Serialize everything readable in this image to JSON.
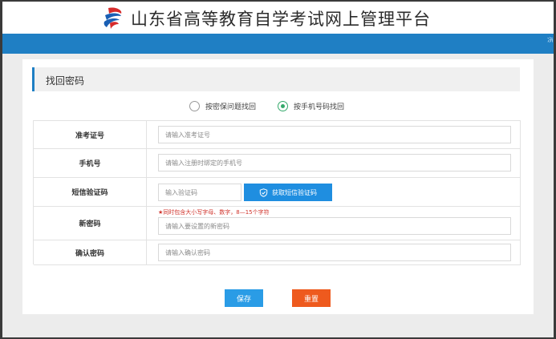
{
  "header": {
    "title": "山东省高等教育自学考试网上管理平台",
    "logo_icon": "shandong-exam-logo-icon",
    "bar_color": "#1f7fc4",
    "bar_edge_text": "浣"
  },
  "section": {
    "title": "找回密码"
  },
  "recovery_options": [
    {
      "label": "按密保问题找回",
      "checked": false
    },
    {
      "label": "按手机号码找回",
      "checked": true
    }
  ],
  "form": {
    "exam_id": {
      "label": "准考证号",
      "placeholder": "请输入准考证号"
    },
    "phone": {
      "label": "手机号",
      "placeholder": "请输入注册时绑定的手机号"
    },
    "sms_code": {
      "label": "短信验证码",
      "placeholder": "输入验证码",
      "button_label": "获取短信验证码",
      "button_icon": "shield-check-icon"
    },
    "new_password": {
      "label": "新密码",
      "hint": "★同时包含大小写字母、数字，8—15个字符",
      "placeholder": "请输入要设置的新密码"
    },
    "confirm_password": {
      "label": "确认密码",
      "placeholder": "请输入确认密码"
    }
  },
  "actions": {
    "save_label": "保存",
    "reset_label": "重置",
    "save_color": "#2a9ce6",
    "reset_color": "#ee5a1e"
  }
}
